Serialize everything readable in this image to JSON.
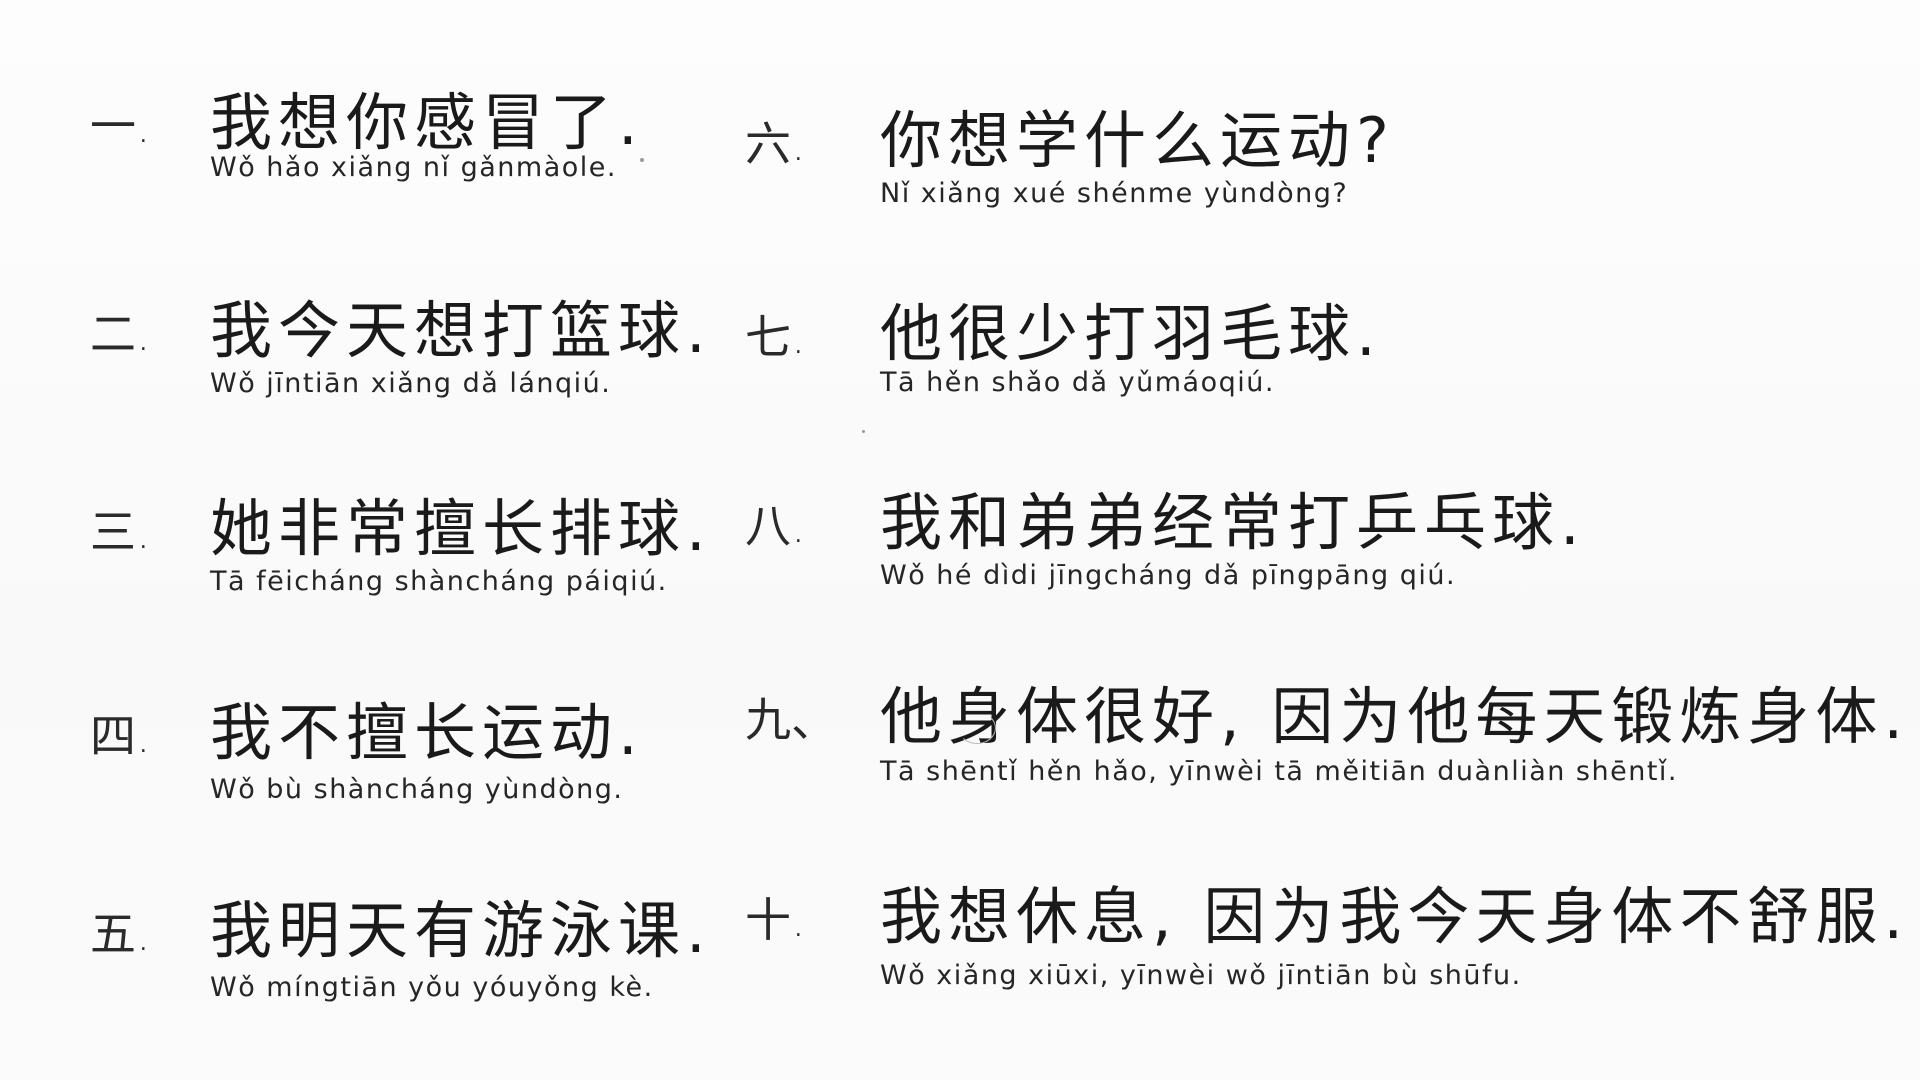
{
  "sentences": [
    {
      "num": "一.",
      "hanzi": "我想你感冒了.",
      "pinyin": "Wǒ hǎo xiǎng nǐ gǎnmàole."
    },
    {
      "num": "二.",
      "hanzi": "我今天想打篮球.",
      "pinyin": "Wǒ jīntiān xiǎng dǎ lánqiú."
    },
    {
      "num": "三.",
      "hanzi": "她非常擅长排球.",
      "pinyin": "Tā fēicháng shàncháng páiqiú."
    },
    {
      "num": "四.",
      "hanzi": "我不擅长运动.",
      "pinyin": "Wǒ bù shàncháng yùndòng."
    },
    {
      "num": "五.",
      "hanzi": "我明天有游泳课.",
      "pinyin": "Wǒ míngtiān yǒu yóuyǒng kè."
    },
    {
      "num": "六.",
      "hanzi": "你想学什么运动?",
      "pinyin": "Nǐ xiǎng xué shénme yùndòng?"
    },
    {
      "num": "七.",
      "hanzi": "他很少打羽毛球.",
      "pinyin": "Tā hěn shǎo dǎ yǔmáoqiú."
    },
    {
      "num": "八.",
      "hanzi": "我和弟弟经常打乒乓球.",
      "pinyin": "Wǒ hé dìdi jīngcháng dǎ pīngpāng qiú."
    },
    {
      "num": "九、",
      "hanzi": "他身体很好, 因为他每天锻炼身体.",
      "pinyin": "Tā shēntǐ hěn hǎo, yīnwèi tā měitiān duànliàn shēntǐ."
    },
    {
      "num": "十.",
      "hanzi": "我想休息, 因为我今天身体不舒服.",
      "pinyin": "Wǒ xiǎng xiūxi, yīnwèi wǒ jīntiān bù shūfu."
    }
  ]
}
